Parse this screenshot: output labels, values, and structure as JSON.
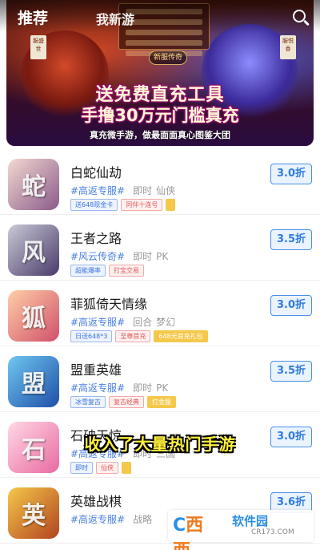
{
  "tabs": {
    "active": "推荐",
    "other": "我新游"
  },
  "banner": {
    "headline1": "送免费直充工具",
    "headline2": "手撸30万元门槛真充",
    "caption": "真充微手游，做最面面真心图鉴大团",
    "sub_logo": "新服传奇",
    "tag_left": "服盛世",
    "tag_right": "服悦香"
  },
  "games": [
    {
      "name": "白蛇仙劫",
      "special": "#高返专服#",
      "tags": [
        "即时",
        "仙侠"
      ],
      "badges": [
        {
          "text": "送648现金卡",
          "style": "blue"
        },
        {
          "text": "同伴十连号",
          "style": "red"
        },
        {
          "text": "",
          "style": "yellow"
        }
      ],
      "discount": "3.0折",
      "icon_colors": [
        "#f3d9d0",
        "#8a5a8a"
      ],
      "icon_glyph": "蛇"
    },
    {
      "name": "王者之路",
      "special": "#风云传奇#",
      "tags": [
        "即时",
        "PK"
      ],
      "badges": [
        {
          "text": "超能爆率",
          "style": "blue"
        },
        {
          "text": "打宝交易",
          "style": "red"
        }
      ],
      "discount": "3.5折",
      "icon_colors": [
        "#c9c9d6",
        "#4a3a6a"
      ],
      "icon_glyph": "风"
    },
    {
      "name": "菲狐倚天情缘",
      "special": "#高返专服#",
      "tags": [
        "回合",
        "梦幻"
      ],
      "badges": [
        {
          "text": "日送648*3",
          "style": "blue"
        },
        {
          "text": "至尊首充",
          "style": "red"
        },
        {
          "text": "648元首充礼包",
          "style": "yellow"
        }
      ],
      "discount": "3.0折",
      "icon_colors": [
        "#ffcfa8",
        "#d0506a"
      ],
      "icon_glyph": "狐"
    },
    {
      "name": "盟重英雄",
      "special": "#高返专服#",
      "tags": [
        "即时",
        "PK"
      ],
      "badges": [
        {
          "text": "冰雪复古",
          "style": "blue"
        },
        {
          "text": "复古经典",
          "style": "red"
        },
        {
          "text": "打金服",
          "style": "yellow"
        }
      ],
      "discount": "3.5折",
      "icon_colors": [
        "#6fc7f0",
        "#1f4fa8"
      ],
      "icon_glyph": "盟"
    },
    {
      "name": "石破天惊",
      "special": "#高返专服#",
      "tags": [
        "即时",
        "三国"
      ],
      "badges": [
        {
          "text": "即时",
          "style": "blue"
        },
        {
          "text": "仙侠",
          "style": "red"
        },
        {
          "text": "",
          "style": "yellow"
        }
      ],
      "discount": "3.0折",
      "icon_colors": [
        "#ffd8e6",
        "#e86aa0"
      ],
      "icon_glyph": "石"
    },
    {
      "name": "英雄战棋",
      "special": "#高返专服#",
      "tags": [
        "战略"
      ],
      "badges": [],
      "discount": "3.6折",
      "icon_colors": [
        "#f5c84a",
        "#b2431f"
      ],
      "icon_glyph": "英"
    }
  ],
  "overlay_subtitle": "收入了大量热门手游",
  "watermark": {
    "logo_a": "C",
    "logo_b": "西西",
    "name": "软件园",
    "url": "CR173.COM"
  }
}
